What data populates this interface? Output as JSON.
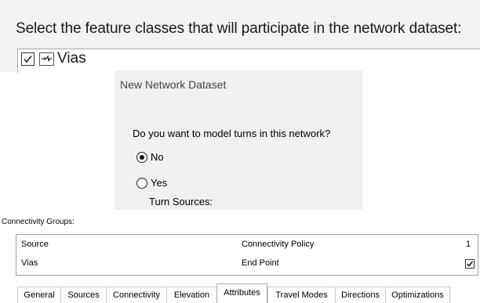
{
  "feature_panel": {
    "prompt": "Select the feature classes that will participate in the network dataset:",
    "item": {
      "name": "Vias",
      "checked": true,
      "icon": "polyline-feature-class-icon"
    }
  },
  "dialog": {
    "title": "New Network Dataset",
    "question": "Do you want to model turns in this network?",
    "options": [
      {
        "label": "No",
        "selected": true
      },
      {
        "label": "Yes",
        "selected": false
      }
    ],
    "turn_sources_label": "Turn Sources:"
  },
  "connectivity": {
    "group_label": "Connectivity Groups:",
    "headers": [
      "Source",
      "Connectivity Policy",
      "1"
    ],
    "rows": [
      {
        "source": "Vias",
        "policy": "End Point",
        "group1": true
      }
    ]
  },
  "tabs": [
    "General",
    "Sources",
    "Connectivity",
    "Elevation",
    "Attributes",
    "Travel Modes",
    "Directions",
    "Optimizations"
  ],
  "active_tab": "Attributes"
}
